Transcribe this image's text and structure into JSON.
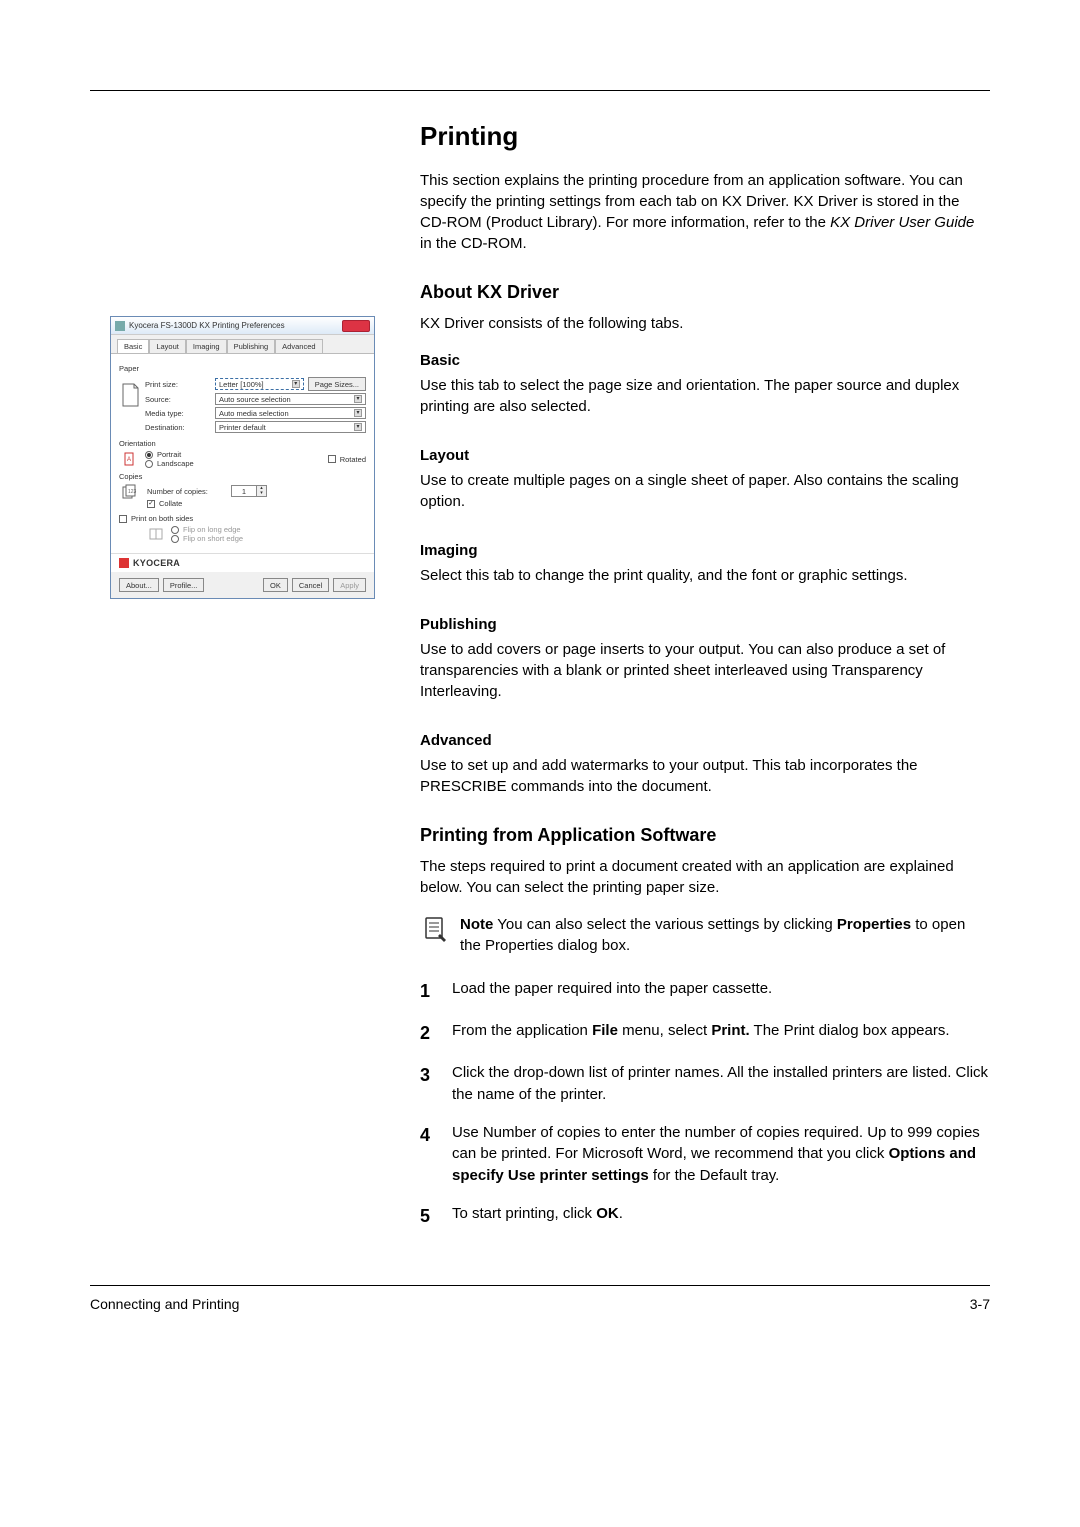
{
  "header_title": "Printing",
  "intro_1": "This section explains the printing procedure from an application software. You can specify the printing settings from each tab on KX Driver. KX Driver is stored in the CD-ROM (Product Library). For more information, refer to the ",
  "intro_italic": "KX Driver User Guide",
  "intro_2": " in the CD-ROM.",
  "about_head": "About KX Driver",
  "about_body": "KX Driver consists of the following tabs.",
  "tabs": {
    "basic": {
      "h": "Basic",
      "p": "Use this tab to select the page size and orientation. The paper source and duplex printing are also selected."
    },
    "layout": {
      "h": "Layout",
      "p": "Use to create multiple pages on a single sheet of paper. Also contains the scaling option."
    },
    "imaging": {
      "h": "Imaging",
      "p": "Select this tab to change the print quality, and the font or graphic settings."
    },
    "publishing": {
      "h": "Publishing",
      "p": "Use to add covers or page inserts to your output. You can also produce a set of transparencies with a blank or printed sheet interleaved using Transparency Interleaving."
    },
    "advanced": {
      "h": "Advanced",
      "p": "Use to set up and add watermarks to your output. This tab incorporates the PRESCRIBE commands into the document."
    }
  },
  "printapp_head": "Printing from Application Software",
  "printapp_body": "The steps required to print a document created with an application are explained below. You can select the printing paper size.",
  "note_lead": "Note",
  "note_line1_rest": "  You can also select the various settings by clicking ",
  "note_bold": "Properties",
  "note_line2": " to open the Properties dialog box.",
  "steps": {
    "s1": "Load the paper required into the paper cassette.",
    "s2a": "From the application ",
    "s2b": "File",
    "s2c": " menu, select ",
    "s2d": "Print.",
    "s2e": " The Print dialog box appears.",
    "s3": "Click the drop-down list of printer names. All the installed printers are listed. Click the name of the printer.",
    "s4a": "Use Number of copies to enter the number of copies required. Up to 999 copies can be printed. For Microsoft Word, we recommend that you click ",
    "s4b": "Options and specify Use printer settings",
    "s4c": " for the Default tray.",
    "s5a": "To start printing, click ",
    "s5b": "OK",
    "s5c": "."
  },
  "nums": {
    "n1": "1",
    "n2": "2",
    "n3": "3",
    "n4": "4",
    "n5": "5"
  },
  "footer_left": "Connecting and Printing",
  "footer_right": "3-7",
  "dialog": {
    "title": "Kyocera FS-1300D KX Printing Preferences",
    "tabs": {
      "t1": "Basic",
      "t2": "Layout",
      "t3": "Imaging",
      "t4": "Publishing",
      "t5": "Advanced"
    },
    "sec_paper": "Paper",
    "row_printsize": "Print size:",
    "val_printsize": "Letter [100%]",
    "btn_pagesizes": "Page Sizes...",
    "row_source": "Source:",
    "val_source": "Auto source selection",
    "row_media": "Media type:",
    "val_media": "Auto media selection",
    "row_dest": "Destination:",
    "val_dest": "Printer default",
    "sec_orient": "Orientation",
    "r_portrait": "Portrait",
    "r_landscape": "Landscape",
    "chk_rotated": "Rotated",
    "sec_copies": "Copies",
    "row_numcopies": "Number of copies:",
    "val_numcopies": "1",
    "chk_collate": "Collate",
    "chk_printboth": "Print on both sides",
    "r_fliplong": "Flip on long edge",
    "r_flipshort": "Flip on short edge",
    "logo": "KYOCERA",
    "btn_about": "About...",
    "btn_profile": "Profile...",
    "btn_ok": "OK",
    "btn_cancel": "Cancel",
    "btn_apply": "Apply"
  }
}
